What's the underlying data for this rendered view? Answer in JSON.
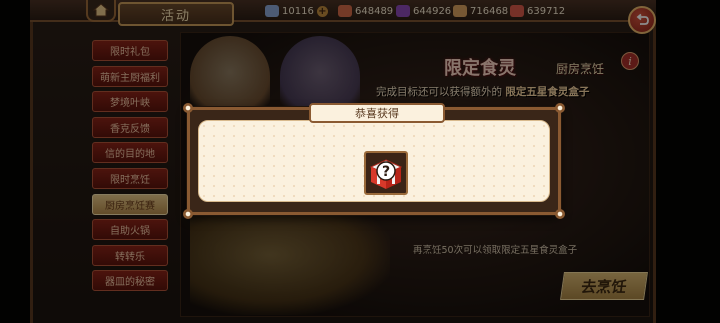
{
  "header": {
    "tab_label": "活动",
    "resources": [
      {
        "name": "crystal",
        "value": "10116",
        "color": "#8aa6d6"
      },
      {
        "name": "food",
        "value": "648489",
        "color": "#d46a48"
      },
      {
        "name": "grape",
        "value": "644926",
        "color": "#8a4ab6"
      },
      {
        "name": "bread",
        "value": "716468",
        "color": "#d9a060"
      },
      {
        "name": "meat",
        "value": "639712",
        "color": "#d85a4a"
      }
    ],
    "plus_label": "+"
  },
  "menu": {
    "items": [
      {
        "label": "限时礼包",
        "active": false
      },
      {
        "label": "萌新主厨福利",
        "active": false
      },
      {
        "label": "梦境叶峡",
        "active": false
      },
      {
        "label": "香克反馈",
        "active": false
      },
      {
        "label": "信的目的地",
        "active": false
      },
      {
        "label": "限时烹饪",
        "active": false
      },
      {
        "label": "厨房烹饪赛",
        "active": true
      },
      {
        "label": "自助火锅",
        "active": false
      },
      {
        "label": "转转乐",
        "active": false
      },
      {
        "label": "器皿的秘密",
        "active": false
      }
    ]
  },
  "banner": {
    "title": "限定食灵",
    "subtitle": "厨房烹饪",
    "line_prefix": "完成目标还可以获得额外的",
    "line_highlight": "限定五星食灵盒子",
    "info_label": "i",
    "progress_text": "再烹饪50次可以领取限定五星食灵盒子",
    "cook_button": "去烹饪"
  },
  "dialog": {
    "title": "恭喜获得",
    "reward_icon": "mystery-gift-box-icon"
  },
  "colors": {
    "accent_red": "#8a2418",
    "gold": "#c99c5a",
    "dialog_bg": "#fbf1de"
  }
}
